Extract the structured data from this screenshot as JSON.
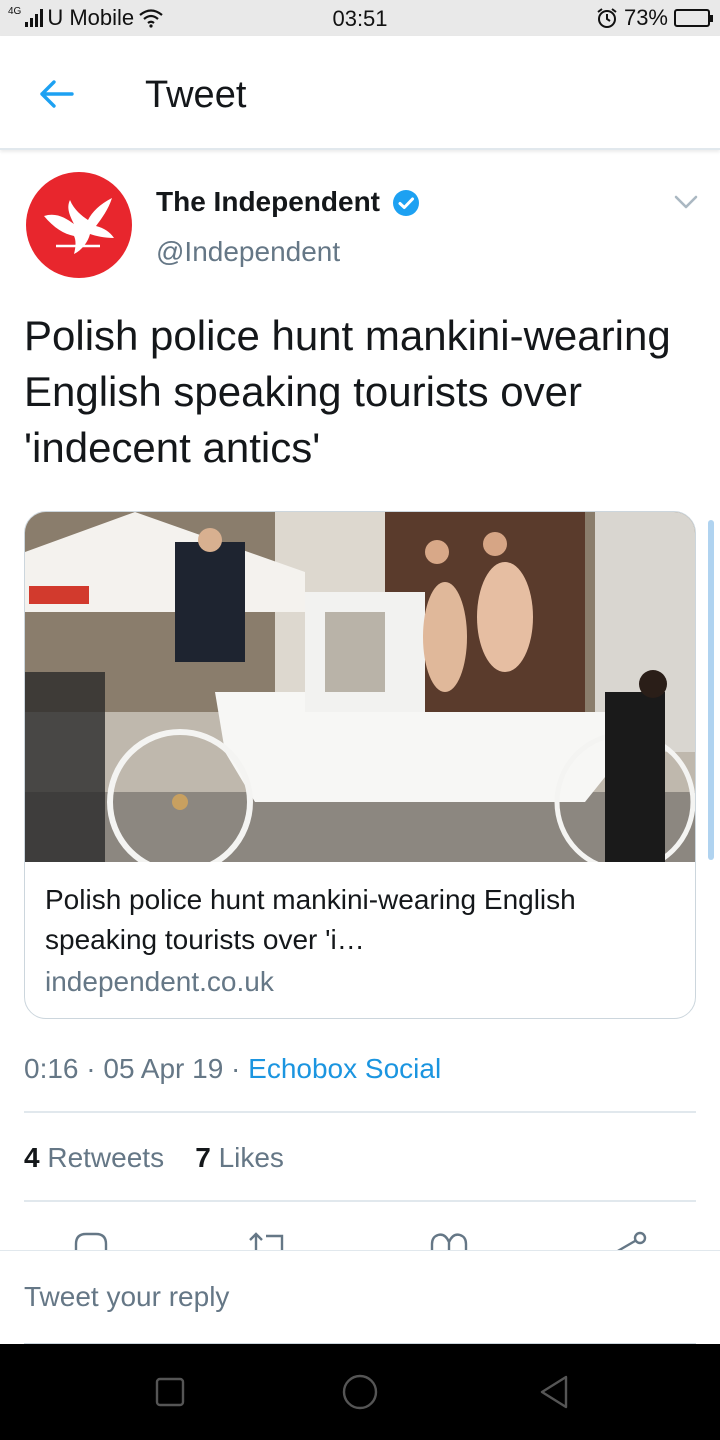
{
  "status_bar": {
    "network_type": "4G",
    "carrier": "U Mobile",
    "time": "03:51",
    "battery": "73%",
    "battery_level": 0.73,
    "icons": [
      "signal-icon",
      "wifi-icon",
      "alarm-icon",
      "battery-icon"
    ]
  },
  "header": {
    "title": "Tweet",
    "back_icon": "arrow-left-icon",
    "accent": "#1da1f2"
  },
  "tweet": {
    "author_name": "The Independent",
    "handle": "@Independent",
    "verified": true,
    "text": "Polish police hunt mankini-wearing English speaking tourists over 'indecent antics'",
    "card": {
      "title": "Polish police hunt mankini-wearing English speaking tourists over 'i…",
      "domain": "independent.co.uk"
    },
    "time": "0:16",
    "date": "05 Apr 19",
    "separator": "·",
    "source": "Echobox Social",
    "retweets_count": "4",
    "retweets_label": "Retweets",
    "likes_count": "7",
    "likes_label": "Likes",
    "actions": [
      "reply-icon",
      "retweet-icon",
      "like-icon",
      "share-icon"
    ]
  },
  "reply": {
    "placeholder": "Tweet your reply"
  },
  "colors": {
    "link": "#1b95e0",
    "secondary_text": "#657786",
    "brand_red": "#e8262d"
  }
}
